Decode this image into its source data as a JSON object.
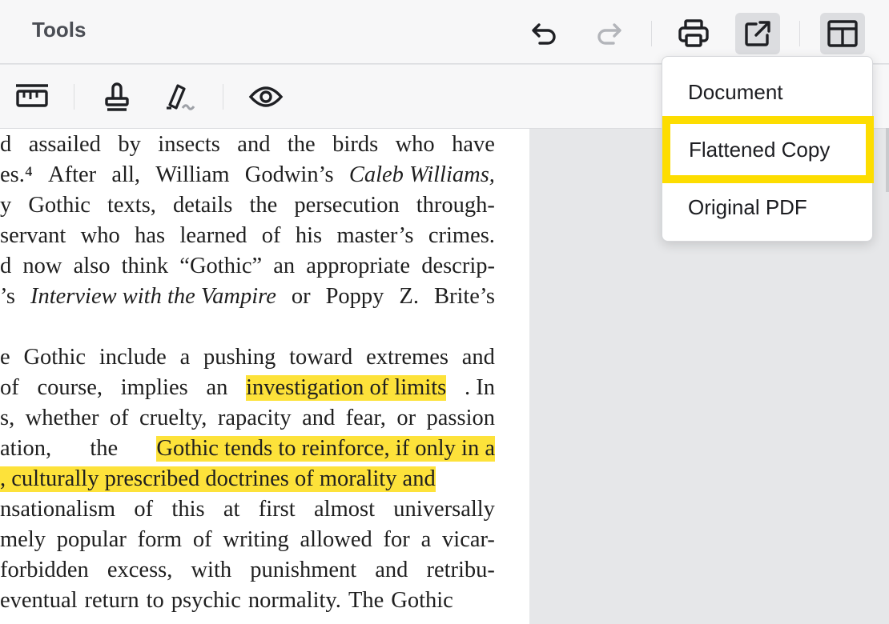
{
  "header": {
    "title": "Tools",
    "buttons": {
      "undo": "undo-icon",
      "redo": "redo-icon",
      "print": "print-icon",
      "export": "export-icon",
      "layout": "layout-panel-icon"
    }
  },
  "toolbar2": {
    "tools": [
      "ruler-icon",
      "stamp-icon",
      "signature-icon",
      "eye-icon"
    ]
  },
  "menu": {
    "items": [
      {
        "label": "Document"
      },
      {
        "label": "Flattened Copy",
        "highlighted": true
      },
      {
        "label": "Original PDF"
      }
    ]
  },
  "document": {
    "lines": [
      [
        {
          "t": "d"
        },
        {
          "t": "assailed"
        },
        {
          "t": "by"
        },
        {
          "t": "insects"
        },
        {
          "t": "and"
        },
        {
          "t": "the"
        },
        {
          "t": "birds"
        },
        {
          "t": "who"
        },
        {
          "t": "have"
        }
      ],
      [
        {
          "t": "es.⁴"
        },
        {
          "t": "After"
        },
        {
          "t": "all,"
        },
        {
          "t": "William"
        },
        {
          "t": "Godwin’s"
        },
        {
          "t": "Caleb Williams,",
          "i": true
        }
      ],
      [
        {
          "t": "y"
        },
        {
          "t": "Gothic"
        },
        {
          "t": "texts,"
        },
        {
          "t": "details"
        },
        {
          "t": "the"
        },
        {
          "t": "persecution"
        },
        {
          "t": "through-"
        }
      ],
      [
        {
          "t": "servant"
        },
        {
          "t": "who"
        },
        {
          "t": "has"
        },
        {
          "t": "learned"
        },
        {
          "t": "of"
        },
        {
          "t": "his"
        },
        {
          "t": "master’s"
        },
        {
          "t": "crimes."
        }
      ],
      [
        {
          "t": "d"
        },
        {
          "t": "now"
        },
        {
          "t": "also"
        },
        {
          "t": "think"
        },
        {
          "t": "“Gothic”"
        },
        {
          "t": "an"
        },
        {
          "t": "appropriate"
        },
        {
          "t": "descrip-"
        }
      ],
      [
        {
          "t": "’s"
        },
        {
          "t": "Interview with the Vampire",
          "i": true
        },
        {
          "t": "or"
        },
        {
          "t": "Poppy"
        },
        {
          "t": "Z."
        },
        {
          "t": "Brite’s"
        }
      ],
      [],
      [
        {
          "t": "e"
        },
        {
          "t": "Gothic"
        },
        {
          "t": "include"
        },
        {
          "t": "a"
        },
        {
          "t": "pushing"
        },
        {
          "t": "toward"
        },
        {
          "t": "extremes"
        },
        {
          "t": "and"
        }
      ],
      [
        {
          "t": "of"
        },
        {
          "t": "course,"
        },
        {
          "t": "implies"
        },
        {
          "t": "an"
        },
        {
          "t": "investigation of limits",
          "h": true
        },
        {
          "t": ". In"
        }
      ],
      [
        {
          "t": "s,"
        },
        {
          "t": "whether"
        },
        {
          "t": "of"
        },
        {
          "t": "cruelty,"
        },
        {
          "t": "rapacity"
        },
        {
          "t": "and"
        },
        {
          "t": "fear,"
        },
        {
          "t": "or"
        },
        {
          "t": "passion"
        }
      ],
      [
        {
          "t": "ation,"
        },
        {
          "t": "the"
        },
        {
          "t": "Gothic tends to reinforce, if only in a",
          "h": true
        }
      ],
      [
        {
          "t": ", culturally prescribed doctrines of morality and",
          "h": true
        }
      ],
      [
        {
          "t": "nsationalism"
        },
        {
          "t": "of"
        },
        {
          "t": "this"
        },
        {
          "t": "at"
        },
        {
          "t": "first"
        },
        {
          "t": "almost"
        },
        {
          "t": "universally"
        }
      ],
      [
        {
          "t": "mely"
        },
        {
          "t": "popular"
        },
        {
          "t": "form"
        },
        {
          "t": "of"
        },
        {
          "t": "writing"
        },
        {
          "t": "allowed"
        },
        {
          "t": "for"
        },
        {
          "t": "a"
        },
        {
          "t": "vicar-"
        }
      ],
      [
        {
          "t": "forbidden"
        },
        {
          "t": "excess,"
        },
        {
          "t": "with"
        },
        {
          "t": "punishment"
        },
        {
          "t": "and"
        },
        {
          "t": "retribu-"
        }
      ],
      [
        {
          "t": "eventual"
        },
        {
          "t": "return"
        },
        {
          "t": "to"
        },
        {
          "t": "psychic"
        },
        {
          "t": "normality."
        },
        {
          "t": "The"
        },
        {
          "t": "Gothic"
        }
      ]
    ]
  }
}
